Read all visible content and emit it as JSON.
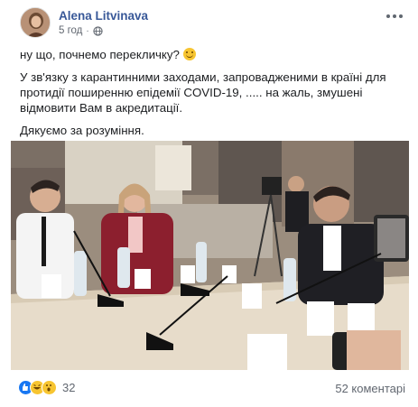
{
  "post": {
    "author": "Alena Litvinava",
    "time": "5 год",
    "more_icon": "more-horizontal-icon",
    "privacy_icon": "globe-icon",
    "lines": [
      "ну що, почнемо перекличку?",
      "У зв'язку з карантинними заходами, запровадженими в країні для протидії поширенню епідемії COVID-19, ..... на жаль, змушені відмовити Вам в акредитації.",
      "Дякуємо за розуміння."
    ]
  },
  "photo": {
    "description_icon": "meeting-photo"
  },
  "footer": {
    "reactions_count": "32",
    "reaction_icons": [
      "like-icon",
      "haha-icon",
      "wow-icon"
    ],
    "comments_label": "52 коментарі"
  }
}
